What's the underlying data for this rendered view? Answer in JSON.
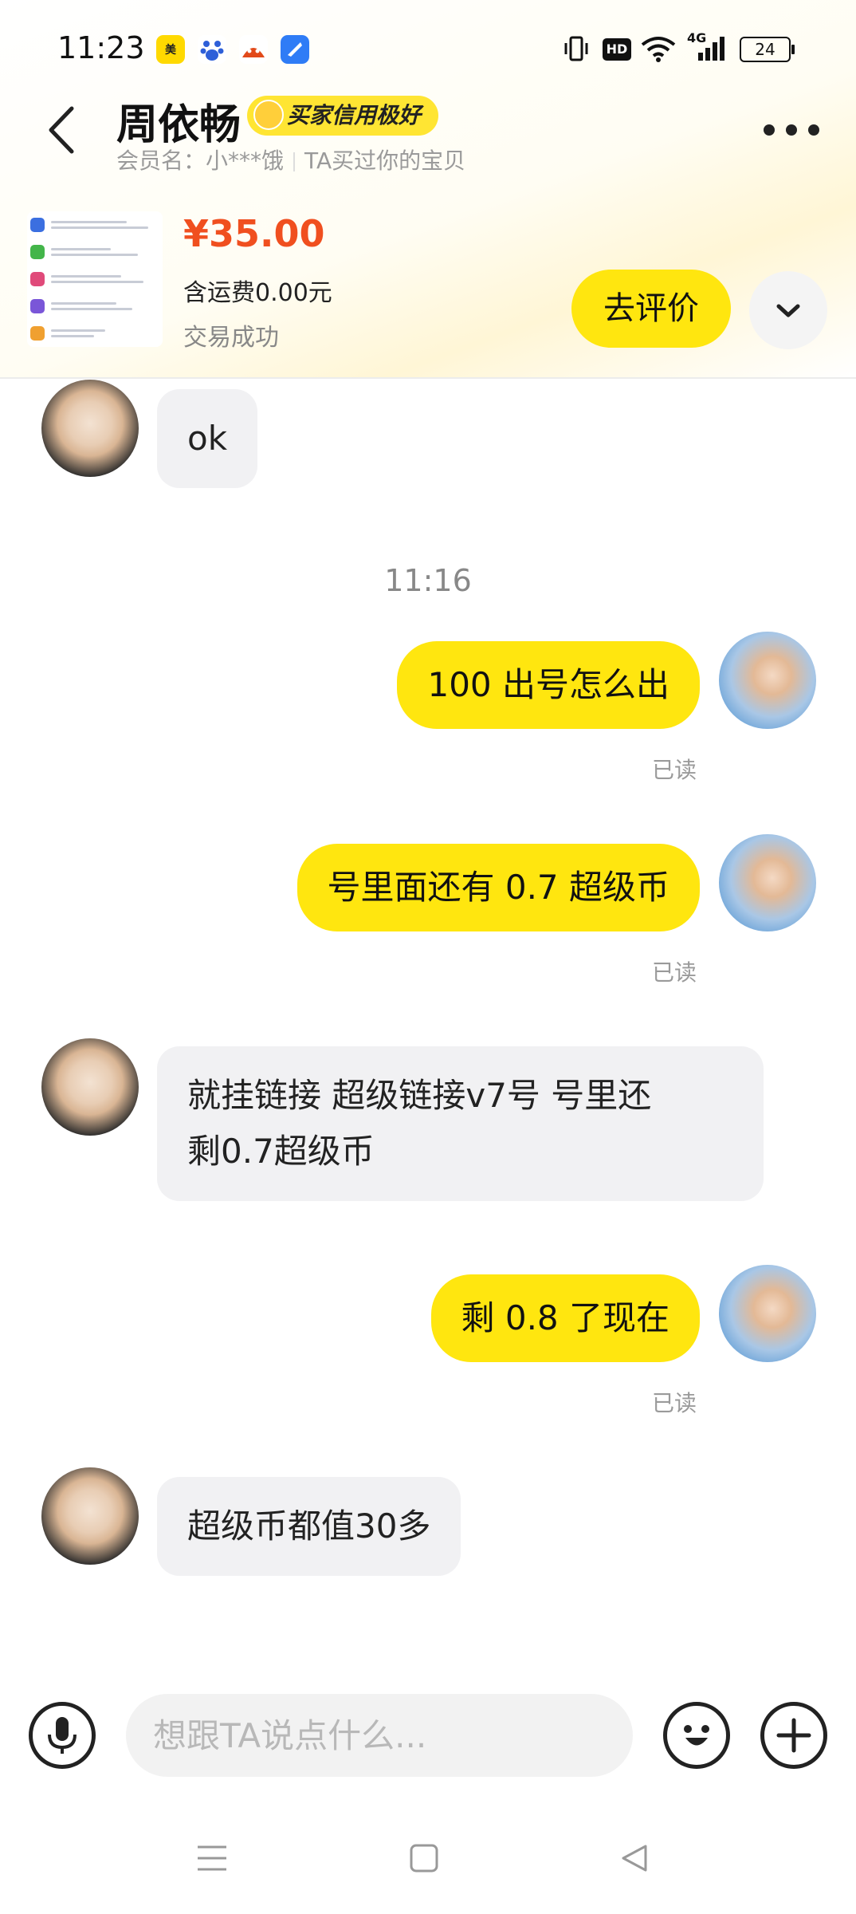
{
  "status_bar": {
    "time": "11:23",
    "app_icons": [
      "meituan-icon",
      "baidu-icon",
      "game-icon",
      "browser-icon"
    ],
    "network": "4G",
    "battery": "24"
  },
  "header": {
    "title": "周依畅",
    "credit_badge": "买家信用极好",
    "member_label": "会员名：小***饿",
    "purchase_note": "TA买过你的宝贝"
  },
  "product": {
    "price": "¥35.00",
    "shipping": "含运费0.00元",
    "status": "交易成功",
    "review_button": "去评价"
  },
  "messages": [
    {
      "side": "left",
      "text": "ok"
    },
    {
      "type": "time",
      "text": "11:16"
    },
    {
      "side": "right",
      "text": "100 出号怎么出",
      "read": "已读"
    },
    {
      "side": "right",
      "text": "号里面还有 0.7 超级币",
      "read": "已读"
    },
    {
      "side": "left",
      "lines": [
        "就挂链接 超级链接v7号 号里还",
        "剩0.7超级币"
      ]
    },
    {
      "side": "right",
      "text": "剩 0.8 了现在",
      "read": "已读"
    },
    {
      "side": "left",
      "text": "超级币都值30多"
    }
  ],
  "input_bar": {
    "placeholder": "想跟TA说点什么..."
  },
  "colors": {
    "accent_yellow": "#ffe60f",
    "price_orange": "#f04f1f",
    "bubble_gray": "#f1f1f3"
  }
}
